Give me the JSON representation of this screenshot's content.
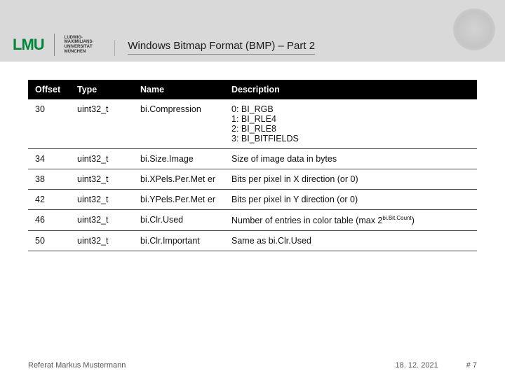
{
  "header": {
    "logo_main": "LMU",
    "logo_sub": "LUDWIG-\nMAXIMILIANS-\nUNIVERSITÄT\nMÜNCHEN",
    "title": "Windows Bitmap Format (BMP) – Part 2"
  },
  "table": {
    "headers": {
      "offset": "Offset",
      "type": "Type",
      "name": "Name",
      "description": "Description"
    },
    "rows": [
      {
        "offset": "30",
        "type": "uint32_t",
        "name": "bi.Compression",
        "description": "0: BI_RGB\n1: BI_RLE4\n2: BI_RLE8\n3: BI_BITFIELDS"
      },
      {
        "offset": "34",
        "type": "uint32_t",
        "name": "bi.Size.Image",
        "description": "Size of image data in bytes"
      },
      {
        "offset": "38",
        "type": "uint32_t",
        "name": "bi.XPels.Per.Met er",
        "description": "Bits per pixel in X direction (or 0)"
      },
      {
        "offset": "42",
        "type": "uint32_t",
        "name": "bi.YPels.Per.Met er",
        "description": "Bits per pixel in Y direction (or 0)"
      },
      {
        "offset": "46",
        "type": "uint32_t",
        "name": "bi.Clr.Used",
        "description_pre": "Number of entries in color table (max 2",
        "description_sup": "bi.Bit.Count",
        "description_post": ")"
      },
      {
        "offset": "50",
        "type": "uint32_t",
        "name": "bi.Clr.Important",
        "description": "Same as bi.Clr.Used"
      }
    ]
  },
  "footer": {
    "left": "Referat Markus Mustermann",
    "date": "18. 12. 2021",
    "page": "# 7"
  }
}
